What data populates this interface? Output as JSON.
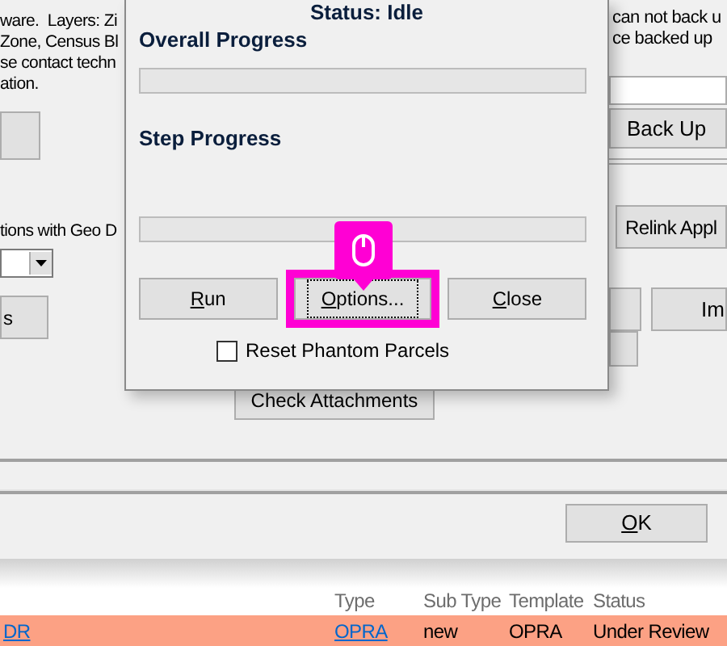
{
  "background": {
    "text_left": [
      "ware.  Layers: Zi",
      "Zone, Census Bl",
      "se contact techn",
      "ation."
    ],
    "text_right": [
      "can not back u",
      "ce backed up"
    ],
    "back_up_button": "Back Up",
    "geo_label": "tions with Geo D",
    "left_button": "s",
    "relink_button": "Relink Appl",
    "import_button": "Im",
    "check_attachments_button": "Check Attachments",
    "ok_button": "OK",
    "table": {
      "columns": [
        "Type",
        "Sub Type",
        "Template",
        "Status"
      ],
      "rows": [
        {
          "link": "DR",
          "type": "OPRA",
          "sub_type": "new",
          "template": "OPRA",
          "status": "Under Review",
          "selected": true
        }
      ]
    }
  },
  "dialog": {
    "title": "Status: Idle",
    "overall_label": "Overall Progress",
    "overall": {
      "level": 0
    },
    "step_label": "Step Progress",
    "step": {
      "level": 0
    },
    "buttons": [
      {
        "label": "Run",
        "focused": false
      },
      {
        "label": "Options...",
        "focused": true
      },
      {
        "label": "Close",
        "focused": false
      }
    ],
    "reset_checkbox": {
      "label": "Reset Phantom Parcels",
      "checked": false
    }
  }
}
